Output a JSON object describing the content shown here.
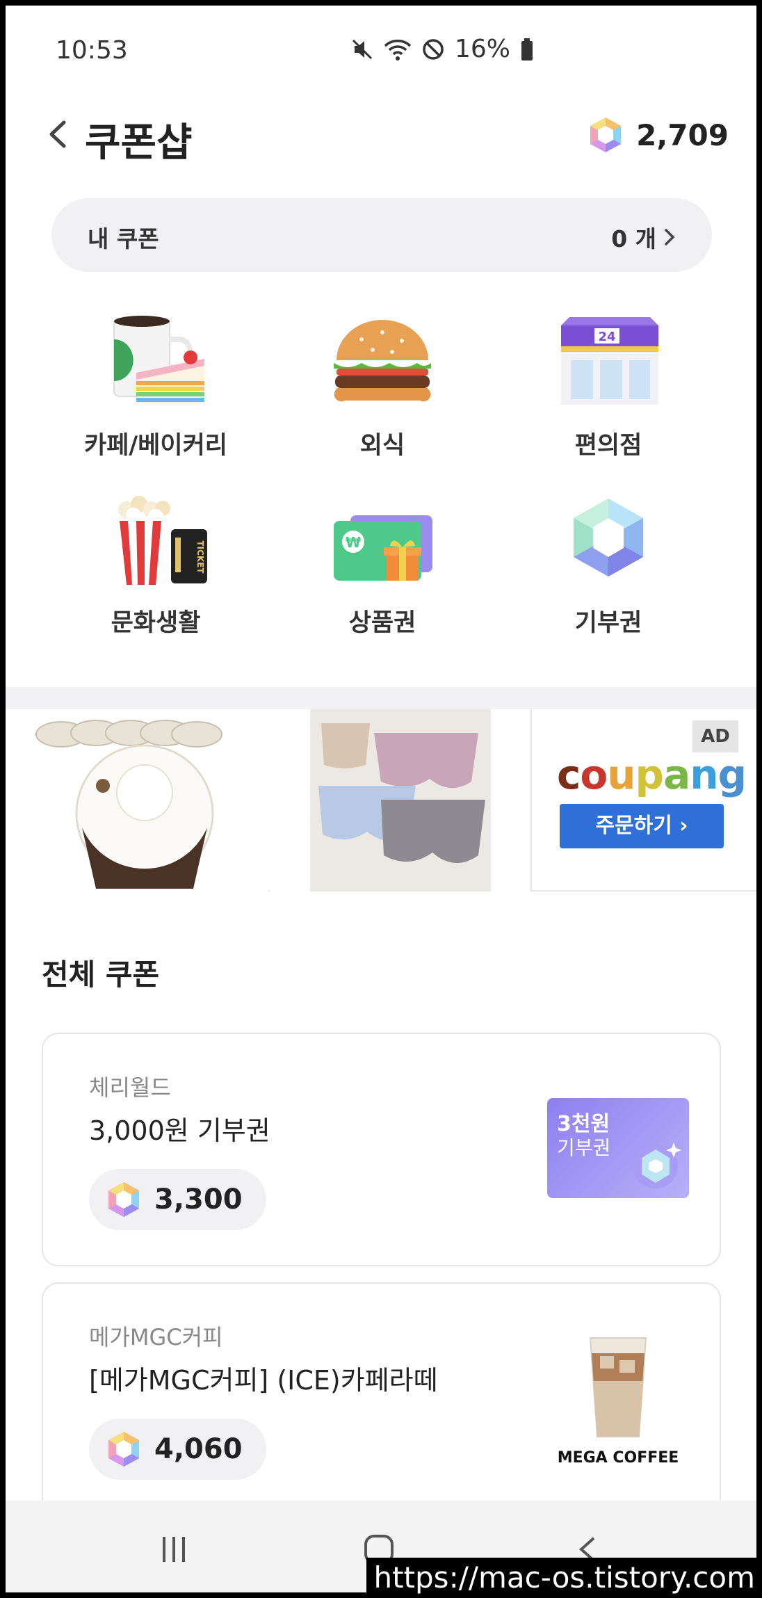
{
  "status_bar": {
    "time": "10:53",
    "battery": "16%"
  },
  "header": {
    "title": "쿠폰샵",
    "points": "2,709"
  },
  "my_coupon": {
    "label": "내 쿠폰",
    "count": "0 개"
  },
  "categories": [
    {
      "label": "카페/베이커리",
      "icon": "cafe-bakery-icon"
    },
    {
      "label": "외식",
      "icon": "burger-icon"
    },
    {
      "label": "편의점",
      "icon": "convenience-store-icon"
    },
    {
      "label": "문화생활",
      "icon": "popcorn-ticket-icon"
    },
    {
      "label": "상품권",
      "icon": "gift-card-icon"
    },
    {
      "label": "기부권",
      "icon": "gem-icon"
    }
  ],
  "ad": {
    "brand": "coupang",
    "button": "주문하기 ›",
    "tag": "AD",
    "store_number": "24",
    "ticket": "TICKET",
    "won": "₩"
  },
  "section": {
    "title": "전체 쿠폰"
  },
  "coupons": [
    {
      "brand": "체리월드",
      "name": "3,000원 기부권",
      "price": "3,300",
      "thumb_line1": "3천원",
      "thumb_line2": "기부권"
    },
    {
      "brand": "메가MGC커피",
      "name": "[메가MGC커피] (ICE)카페라떼",
      "price": "4,060",
      "thumb_label": "MEGA COFFEE"
    }
  ],
  "watermark": "https://mac-os.tistory.com",
  "colors": {
    "accent_blue": "#2f6fd8",
    "gem_purple": "#8f7ff0",
    "card_border": "#e6e6e6"
  }
}
